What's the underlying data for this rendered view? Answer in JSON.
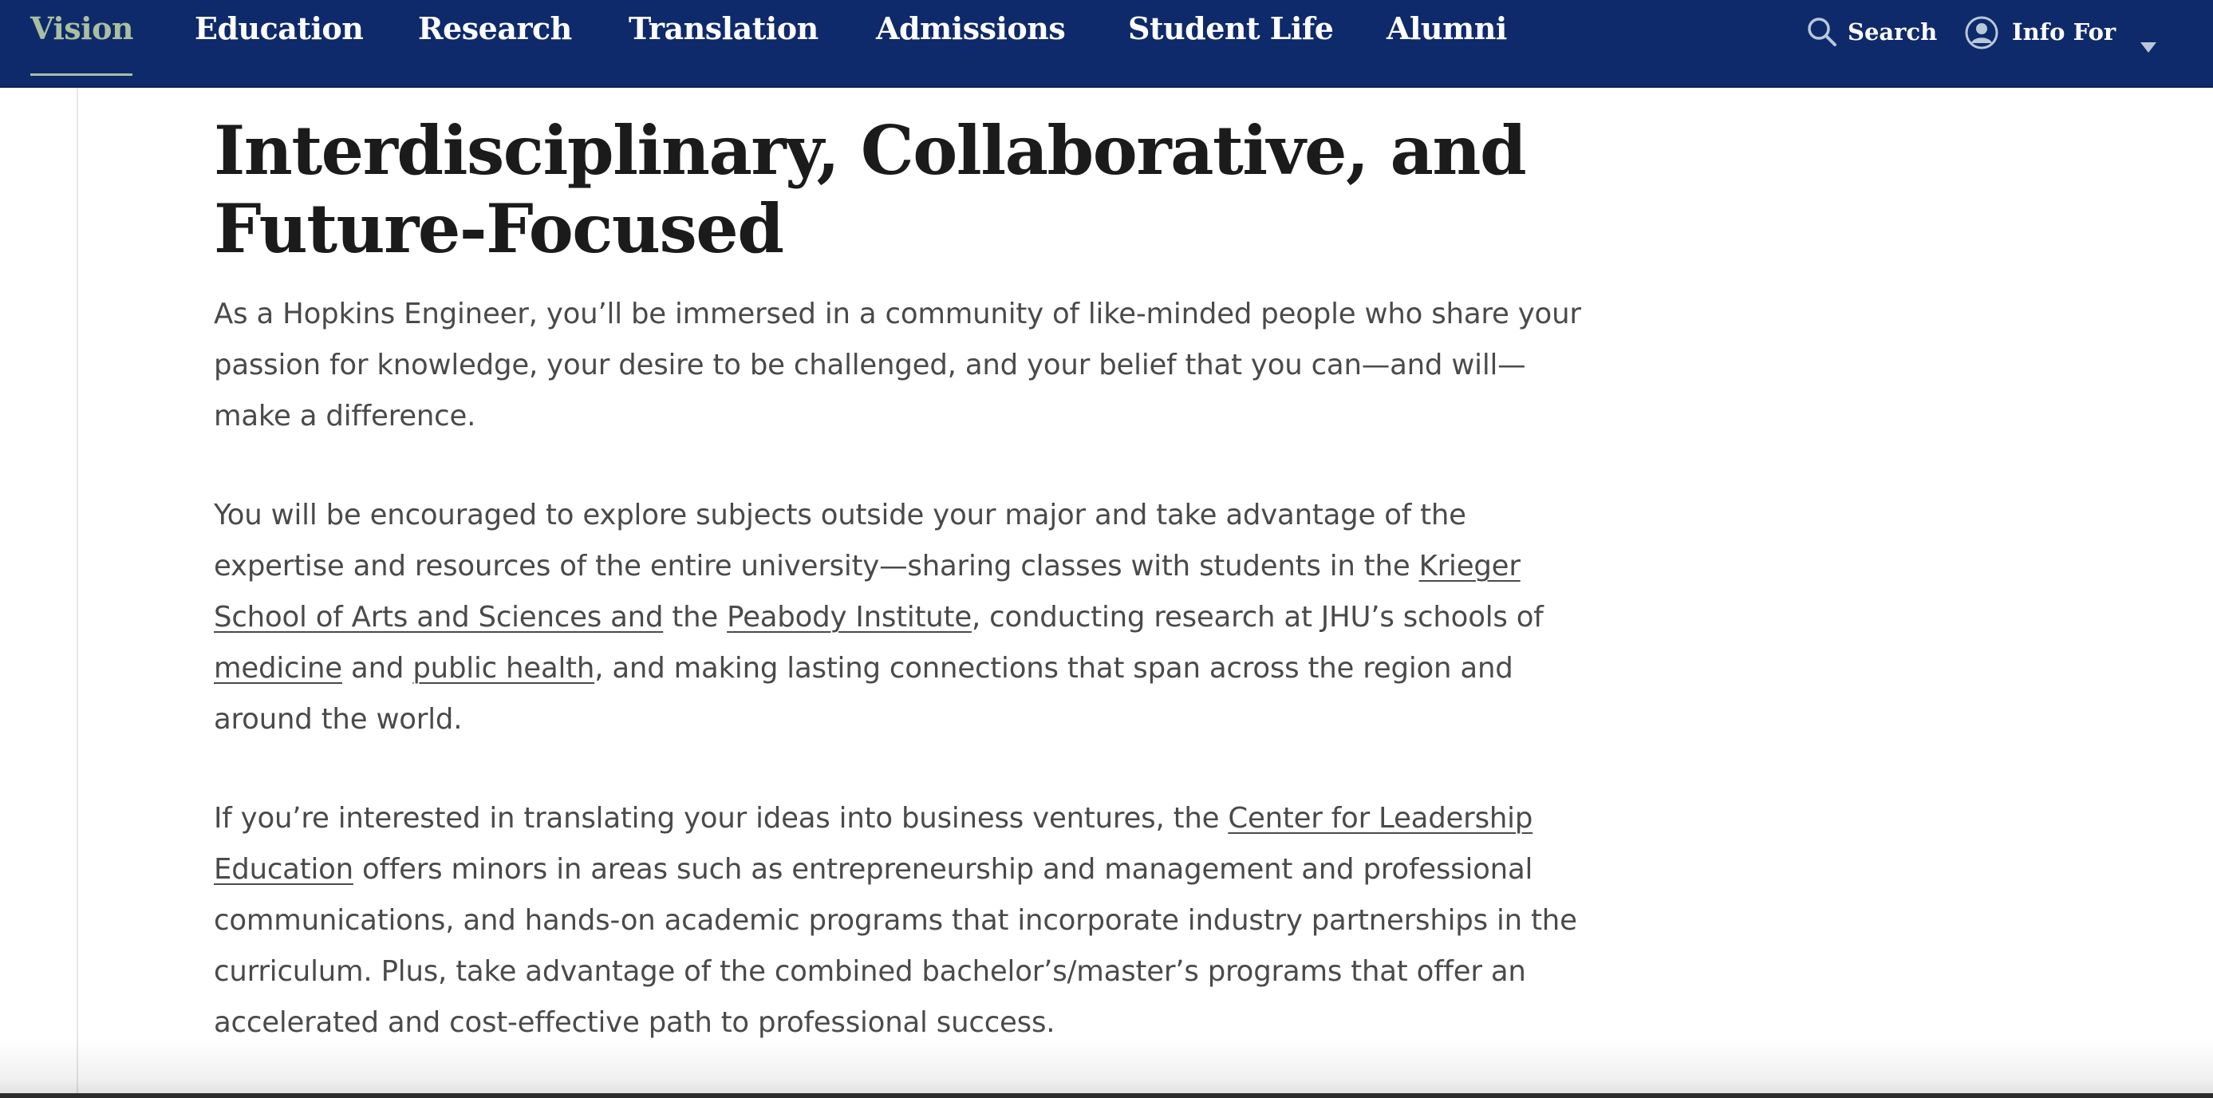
{
  "nav": {
    "items": [
      {
        "label": "Vision",
        "active": true
      },
      {
        "label": "Education"
      },
      {
        "label": "Research"
      },
      {
        "label": "Translation"
      },
      {
        "label": "Admissions"
      },
      {
        "label": "Student Life"
      },
      {
        "label": "Alumni"
      }
    ],
    "search_label": "Search",
    "info_for_label": "Info For"
  },
  "colors": {
    "nav_background": "#0f2a6b",
    "nav_active": "#a9bfa0",
    "heading": "#1b1b1b",
    "body_text": "#4a4a4a"
  },
  "main": {
    "heading": "Interdisciplinary, Collaborative, and Future-Focused",
    "paragraph_1": "As a Hopkins Engineer, you’ll be immersed in a community of like-minded people who share your passion for knowledge, your desire to be challenged, and your belief that you can—and will—make a difference.",
    "paragraph_2": {
      "t1": "You will be encouraged to explore subjects outside your major and take advantage of the expertise and resources of the entire university—sharing classes with students in the ",
      "link_krieger": "Krieger School of Arts and Sciences and",
      "t2": " the ",
      "link_peabody": "Peabody Institute",
      "t3": ", conducting research at JHU’s schools of ",
      "link_medicine": "medicine",
      "t4": " and ",
      "link_public_health": "public health",
      "t5": ", and making lasting connections that span across the region and around the world."
    },
    "paragraph_3": {
      "t1": "If you’re interested in translating your ideas into business ventures, the ",
      "link_cle": "Center for Leadership Education",
      "t2": " offers minors in areas such as entrepreneurship and management and professional communications, and hands-on academic programs that incorporate industry partnerships in the curriculum. Plus, take advantage of the combined bachelor’s/master’s programs that offer an accelerated and cost-effective path to professional success."
    }
  }
}
